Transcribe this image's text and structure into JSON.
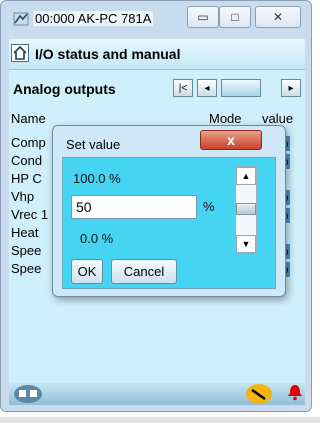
{
  "window": {
    "title": "00:000 AK-PC 781A",
    "controls": {
      "minimize": "▭",
      "maximize": "□",
      "close": "✕"
    }
  },
  "header": {
    "title": "I/O status and manual"
  },
  "section": {
    "title": "Analog outputs",
    "nav": {
      "first": "|<",
      "prev": "◂",
      "next": "▸"
    }
  },
  "columns": {
    "name": "Name",
    "mode": "Mode",
    "value": "value"
  },
  "rows": [
    {
      "name": "Comp",
      "value": "%"
    },
    {
      "name": "Cond",
      "value": "%"
    },
    {
      "name": "HP C",
      "value": ""
    },
    {
      "name": "Vhp",
      "value": "%"
    },
    {
      "name": "Vrec 1",
      "value": "%"
    },
    {
      "name": "Heat",
      "value": ""
    },
    {
      "name": "Spee",
      "value": "%"
    },
    {
      "name": "Spee",
      "value": "%"
    }
  ],
  "dialog": {
    "title": "Set value",
    "close_label": "x",
    "max_label": "100.0 %",
    "input_value": "50",
    "unit": "%",
    "min_label": "0.0 %",
    "ok_label": "OK",
    "cancel_label": "Cancel"
  },
  "colors": {
    "dialog_body": "#45d5f2",
    "client_bg": "#cfeffb",
    "value_cell": "#4e93c5",
    "alarm_icon": "#e00000"
  },
  "icons": {
    "app": "app-icon",
    "home": "home-icon",
    "network": "network-icon",
    "tool": "tool-icon",
    "bell": "bell-icon"
  }
}
